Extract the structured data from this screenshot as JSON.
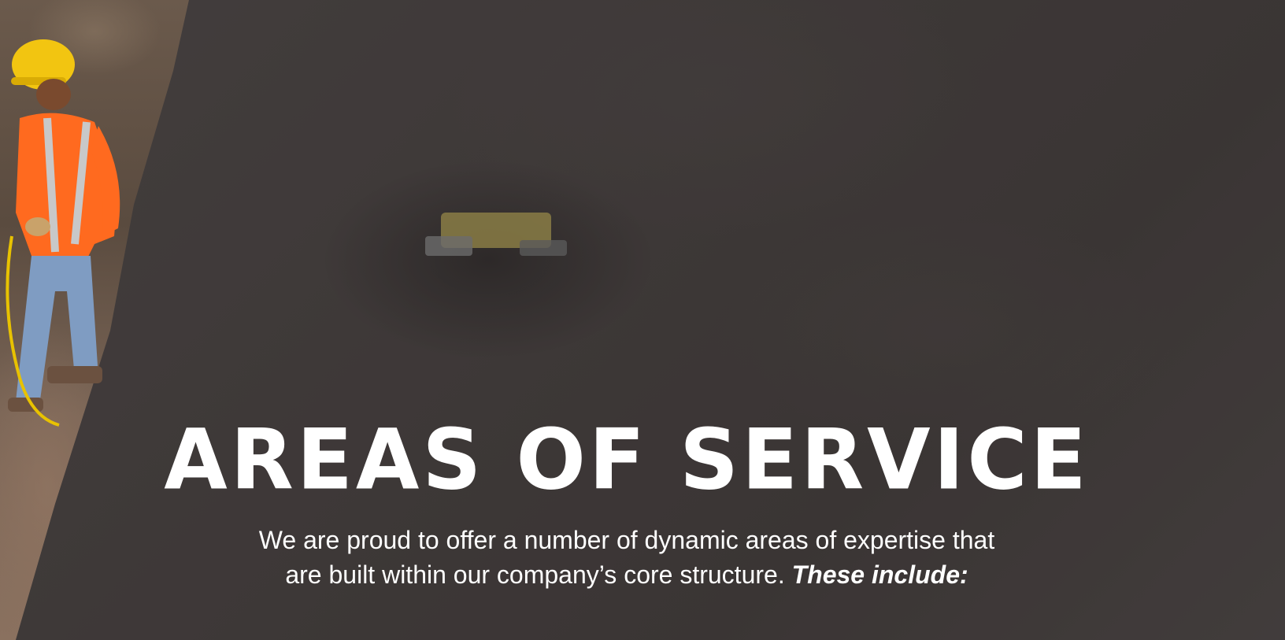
{
  "heading": "AREAS OF SERVICE",
  "intro": {
    "line1": "We are proud to offer a number of dynamic areas of expertise that",
    "line2_plain": "are built within our company’s core structure.",
    "line2_emphasis": "These include:"
  },
  "colors": {
    "text": "#ffffff",
    "overlay": "#3e3a3a",
    "helmet": "#f2c511",
    "vest": "#ff6a1f"
  },
  "icons": {
    "worker": "construction-worker-photo",
    "machine": "compactor-machine-photo"
  }
}
